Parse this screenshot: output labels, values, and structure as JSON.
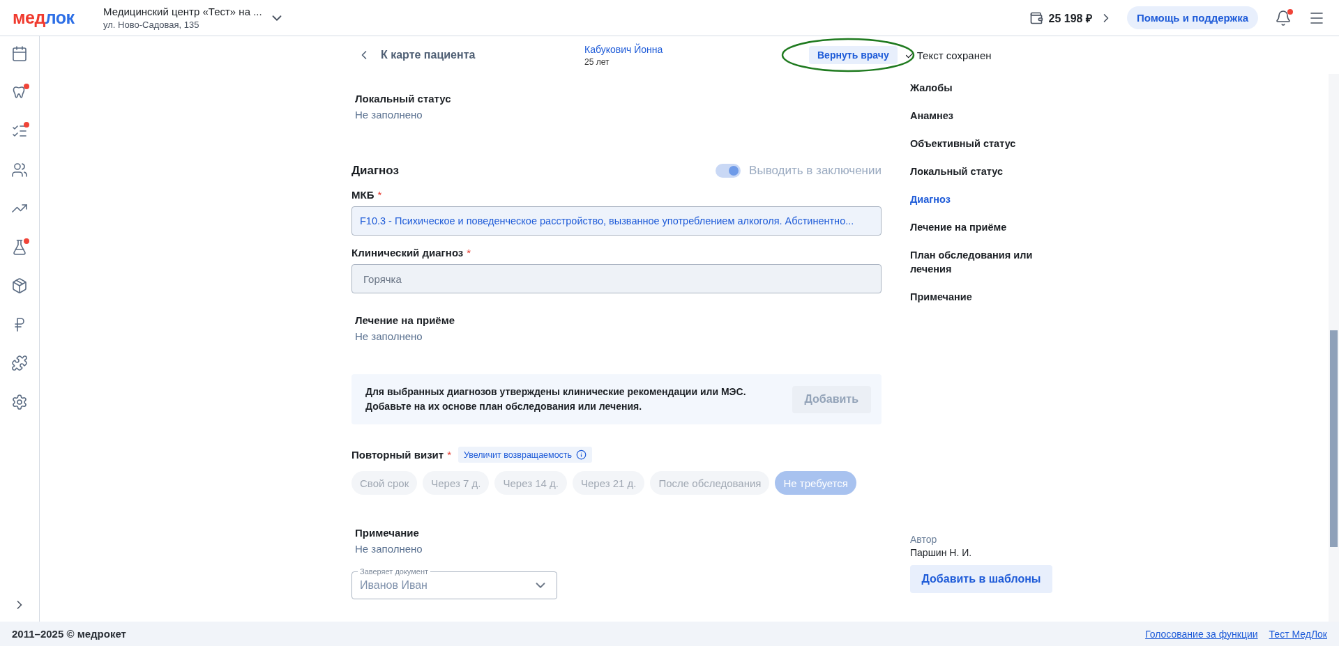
{
  "header": {
    "logo_parts": [
      {
        "text": "мед",
        "color": "#f03a2e"
      },
      {
        "text": "лок",
        "color": "#2d6fe6"
      }
    ],
    "clinic": {
      "name": "Медицинский центр «Тест» на ...",
      "address": "ул. Ново-Садовая, 135"
    },
    "balance": "25 198 ₽",
    "help_button": "Помощь и поддержка",
    "notifications_badge": true
  },
  "sidebar": {
    "items": [
      {
        "badge": false
      },
      {
        "badge": true
      },
      {
        "badge": true
      },
      {
        "badge": false
      },
      {
        "badge": false
      },
      {
        "badge": true
      },
      {
        "badge": false
      },
      {
        "badge": false
      },
      {
        "badge": false
      },
      {
        "badge": false
      }
    ]
  },
  "topbar": {
    "back_link": "К карте пациента",
    "patient": {
      "name": "Кабукович Йонна",
      "age": "25 лет"
    },
    "return_button": "Вернуть врачу",
    "save_status": "Текст сохранен"
  },
  "sections": [
    {
      "kind": "view",
      "title": "Локальный статус",
      "value": "Не заполнено"
    },
    {
      "kind": "diagnosis",
      "title": "Диагноз",
      "toggle": {
        "label": "Выводить в заключении",
        "on": true,
        "disabled": true
      },
      "mkb": {
        "label": "МКБ",
        "required_mark": "*",
        "value": "F10.3 - Психическое и поведенческое расстройство, вызванное употреблением алкоголя. Абстинентно..."
      },
      "clinical": {
        "label": "Клинический диагноз",
        "required_mark": "*",
        "value": "Горячка"
      }
    },
    {
      "kind": "view",
      "title": "Лечение на приёме",
      "value": "Не заполнено"
    },
    {
      "kind": "notice",
      "text": "Для выбранных диагнозов утверждены клинические рекомендации или МЭС. Добавьте на их основе план обследования или лечения.",
      "button": "Добавить",
      "button_disabled": true
    },
    {
      "kind": "chips",
      "title": "Повторный визит",
      "required_mark": "*",
      "hint": "Увеличит возвращаемость",
      "disabled": true,
      "options": [
        {
          "label": "Свой срок",
          "selected": false
        },
        {
          "label": "Через 7 д.",
          "selected": false
        },
        {
          "label": "Через 14 д.",
          "selected": false
        },
        {
          "label": "Через 21 д.",
          "selected": false
        },
        {
          "label": "После обследования",
          "selected": false
        },
        {
          "label": "Не требуется",
          "selected": true
        }
      ]
    },
    {
      "kind": "view",
      "title": "Примечание",
      "value": "Не заполнено"
    },
    {
      "kind": "select",
      "label": "Заверяет документ",
      "value": "Иванов Иван"
    }
  ],
  "nav": {
    "items": [
      {
        "label": "Жалобы",
        "selected": false
      },
      {
        "label": "Анамнез",
        "selected": false
      },
      {
        "label": "Объективный статус",
        "selected": false
      },
      {
        "label": "Локальный статус",
        "selected": false
      },
      {
        "label": "Диагноз",
        "selected": true
      },
      {
        "label": "Лечение на приёме",
        "selected": false
      },
      {
        "label": "План обследования или лечения",
        "selected": false
      },
      {
        "label": "Примечание",
        "selected": false
      }
    ],
    "author_label": "Автор",
    "author": "Паршин Н. И.",
    "templates_button": "Добавить в шаблоны"
  },
  "footer": {
    "copyright": "2011–2025 © медрокет",
    "links": [
      "Голосование за функции",
      "Тест МедЛок"
    ]
  }
}
